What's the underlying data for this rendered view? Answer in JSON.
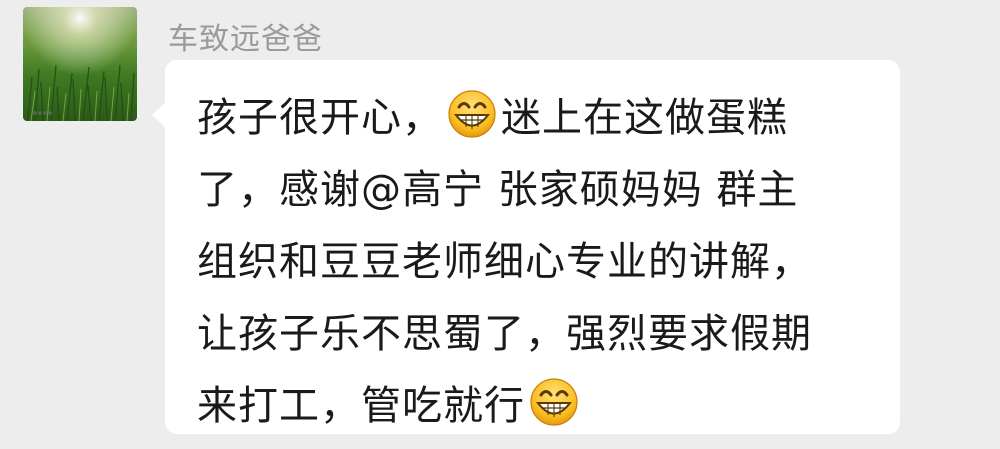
{
  "message": {
    "sender_name": "车致远爸爸",
    "lines": [
      [
        "孩子很开心，",
        "迷上在这做蛋糕"
      ],
      [
        "了，感谢@高宁 张家硕妈妈  群主"
      ],
      [
        "组织和豆豆老师细心专业的讲解，"
      ],
      [
        "让孩子乐不思蜀了，强烈要求假期"
      ],
      [
        "来打工，管吃就行"
      ]
    ],
    "emoji": "grinning-face-emoji"
  },
  "colors": {
    "background": "#ededed",
    "bubble": "#ffffff",
    "sender_name": "#9a9a9a",
    "text": "#1a1a1a"
  }
}
